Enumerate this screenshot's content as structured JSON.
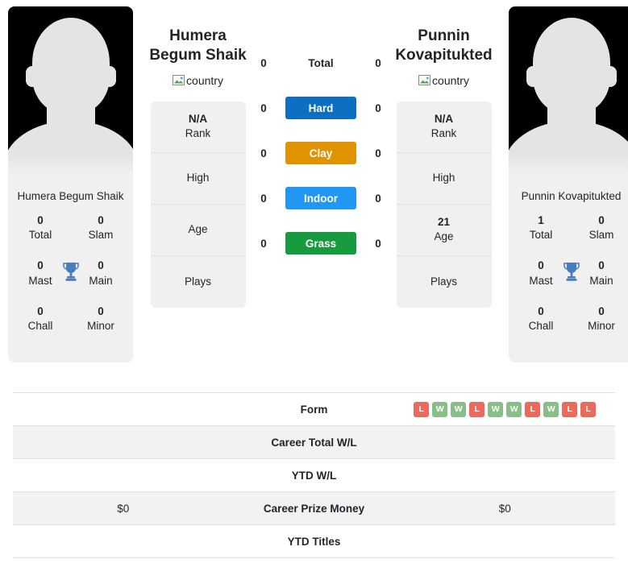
{
  "players": [
    {
      "name": "Humera Begum Shaik",
      "display_name_lines": [
        "Humera",
        "Begum Shaik"
      ],
      "country_alt": "country",
      "titles": {
        "total": "0",
        "total_label": "Total",
        "slam": "0",
        "slam_label": "Slam",
        "mast": "0",
        "mast_label": "Mast",
        "main": "0",
        "main_label": "Main",
        "chall": "0",
        "chall_label": "Chall",
        "minor": "0",
        "minor_label": "Minor"
      },
      "info": [
        {
          "value": "N/A",
          "label": "Rank"
        },
        {
          "value": "",
          "label": "High"
        },
        {
          "value": "",
          "label": "Age"
        },
        {
          "value": "",
          "label": "Plays"
        }
      ]
    },
    {
      "name": "Punnin Kovapitukted",
      "display_name_lines": [
        "Punnin",
        "Kovapitukted"
      ],
      "country_alt": "country",
      "titles": {
        "total": "1",
        "total_label": "Total",
        "slam": "0",
        "slam_label": "Slam",
        "mast": "0",
        "mast_label": "Mast",
        "main": "0",
        "main_label": "Main",
        "chall": "0",
        "chall_label": "Chall",
        "minor": "0",
        "minor_label": "Minor"
      },
      "info": [
        {
          "value": "N/A",
          "label": "Rank"
        },
        {
          "value": "",
          "label": "High"
        },
        {
          "value": "21",
          "label": "Age"
        },
        {
          "value": "",
          "label": "Plays"
        }
      ]
    }
  ],
  "surfaces": [
    {
      "label": "Total",
      "left": "0",
      "right": "0",
      "color": "transparent",
      "plain": true
    },
    {
      "label": "Hard",
      "left": "0",
      "right": "0",
      "color": "#0c6fc1",
      "plain": false
    },
    {
      "label": "Clay",
      "left": "0",
      "right": "0",
      "color": "#e09200",
      "plain": false
    },
    {
      "label": "Indoor",
      "left": "0",
      "right": "0",
      "color": "#2196f3",
      "plain": false
    },
    {
      "label": "Grass",
      "left": "0",
      "right": "0",
      "color": "#189b3f",
      "plain": false
    }
  ],
  "comparison_rows": [
    {
      "label": "Form",
      "left": "",
      "right": "",
      "right_form": [
        "L",
        "W",
        "W",
        "L",
        "W",
        "W",
        "L",
        "W",
        "L",
        "L"
      ],
      "shaded": false
    },
    {
      "label": "Career Total W/L",
      "left": "",
      "right": "",
      "shaded": true
    },
    {
      "label": "YTD W/L",
      "left": "",
      "right": "",
      "shaded": false
    },
    {
      "label": "Career Prize Money",
      "left": "$0",
      "right": "$0",
      "shaded": true
    },
    {
      "label": "YTD Titles",
      "left": "",
      "right": "",
      "shaded": false
    }
  ],
  "colors": {
    "win_badge": "#87bf87",
    "loss_badge": "#ec6a5c",
    "trophy": "#4a7ebb",
    "card_bg": "#f0f0f0"
  }
}
